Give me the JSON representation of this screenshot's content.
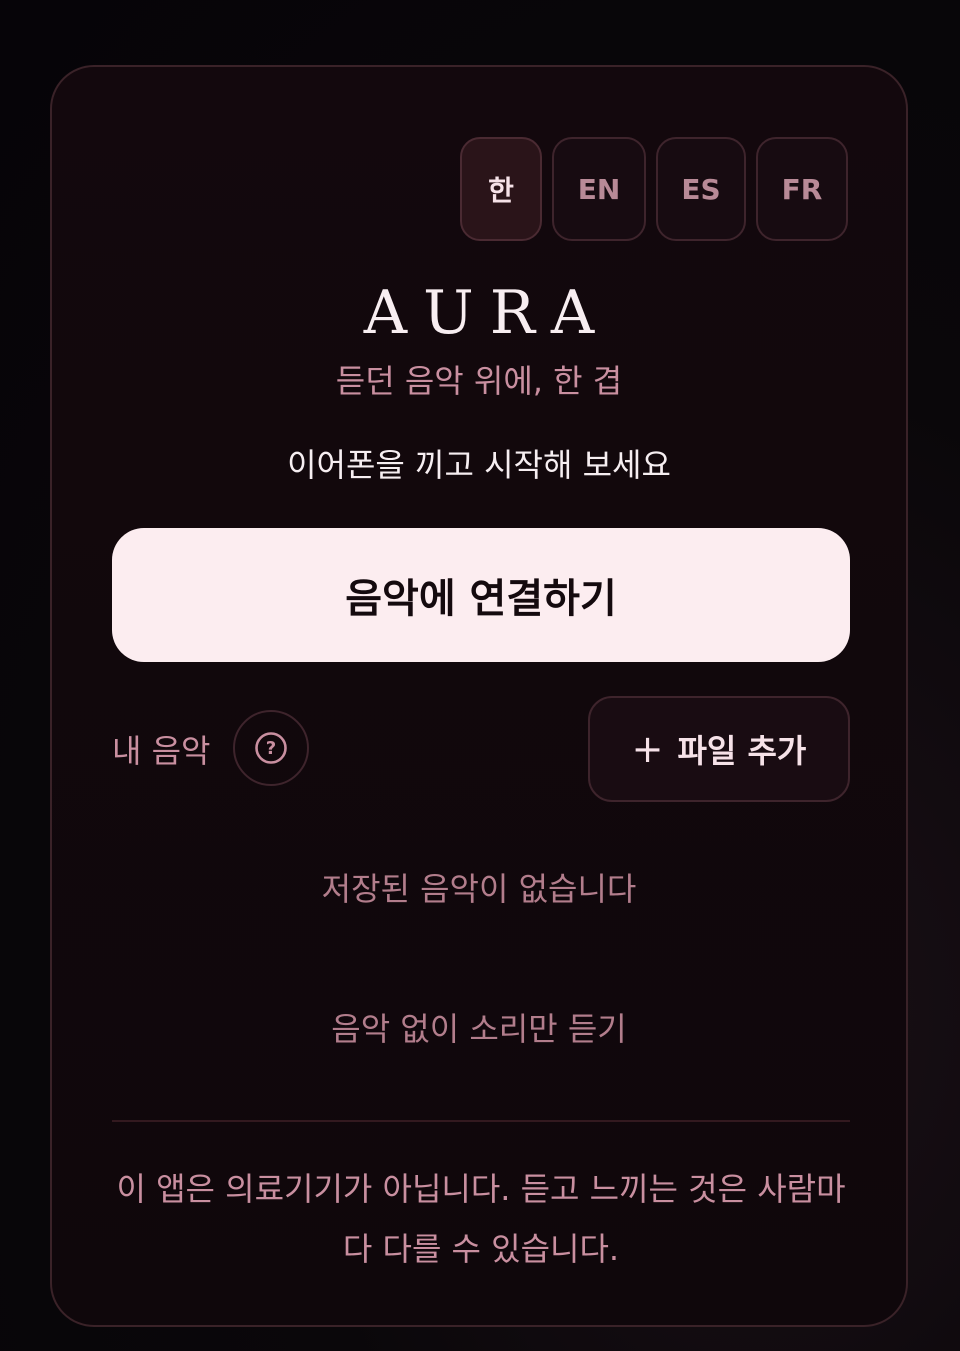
{
  "languages": [
    {
      "label": "한",
      "active": true
    },
    {
      "label": "EN",
      "active": false
    },
    {
      "label": "ES",
      "active": false
    },
    {
      "label": "FR",
      "active": false
    }
  ],
  "app": {
    "title": "AURA",
    "subtitle": "듣던 음악 위에, 한 겹",
    "prompt": "이어폰을 끼고 시작해 보세요"
  },
  "actions": {
    "connect_label": "음악에 연결하기",
    "my_music_label": "내 음악",
    "add_file_label": "파일 추가",
    "add_file_plus": "+",
    "help_glyph": "?",
    "sound_only_label": "음악 없이 소리만 듣기"
  },
  "library": {
    "empty_message": "저장된 음악이 없습니다"
  },
  "footer": {
    "disclaimer": "이 앱은 의료기기가 아닙니다. 듣고 느끼는 것은 사람마다 다를 수 있습니다."
  },
  "colors": {
    "accent": "#c98fa0",
    "primary_button": "#fcedf0",
    "background": "#0f070b"
  }
}
